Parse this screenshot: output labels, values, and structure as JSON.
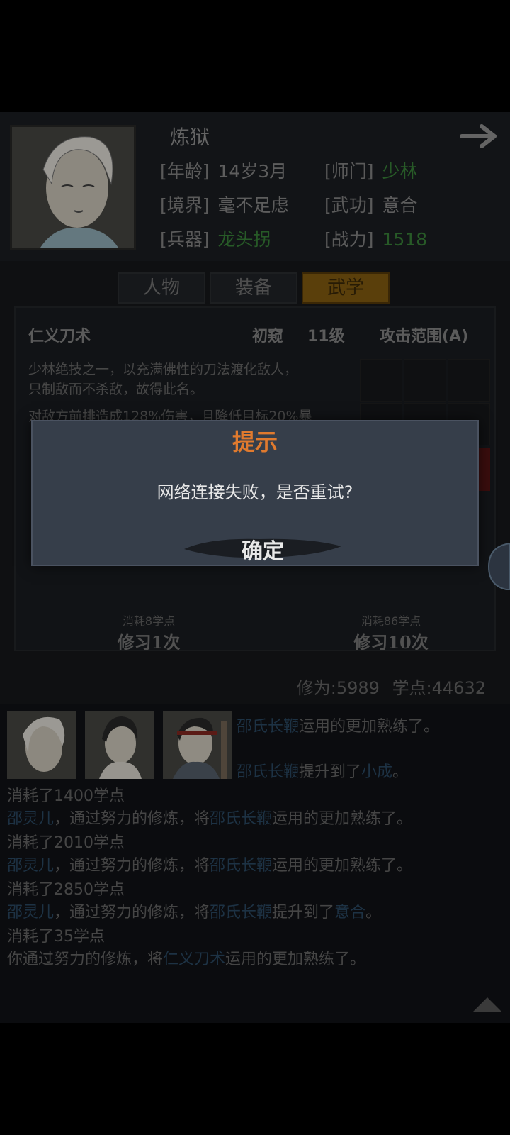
{
  "profile": {
    "name": "炼狱",
    "age_label": "[年龄]",
    "age": "14岁3月",
    "sect_label": "[师门]",
    "sect": "少林",
    "realm_label": "[境界]",
    "realm": "毫不足虑",
    "martial_label": "[武功]",
    "martial": "意合",
    "weapon_label": "[兵器]",
    "weapon": "龙头拐",
    "power_label": "[战力]",
    "power": "1518",
    "green_color": "#3d8a3d"
  },
  "tabs": [
    {
      "label": "人物",
      "active": false
    },
    {
      "label": "装备",
      "active": false
    },
    {
      "label": "武学",
      "active": true
    }
  ],
  "skill": {
    "name": "仁义刀术",
    "tier": "初窥",
    "level": "11级",
    "range": "攻击范围(A)",
    "desc1": "少林绝技之一，以充满佛性的刀法渡化敌人，",
    "desc2": "只制敌而不杀敌，故得此名。",
    "desc3": "对敌方前排造成128%伤害，且降低目标20%暴",
    "cost1": "消耗8学点",
    "learn1": "修习1次",
    "cost10": "消耗86学点",
    "learn10": "修习10次"
  },
  "stats": {
    "cultivation": "修为:5989",
    "points": "学点:44632"
  },
  "log": {
    "l1a": "邵氏长鞭",
    "l1b": "运用的更加熟练了。",
    "l2a": "邵氏长鞭",
    "l2b": "提升到了",
    "l2c": "小成",
    "l2d": "。",
    "l3": "消耗了1400学点",
    "l4a": "邵灵儿",
    "l4b": "，通过努力的修炼，将",
    "l4c": "邵氏长鞭",
    "l4d": "运用的更加熟练了。",
    "l5": "消耗了2010学点",
    "l6a": "邵灵儿",
    "l6b": "，通过努力的修炼，将",
    "l6c": "邵氏长鞭",
    "l6d": "运用的更加熟练了。",
    "l7": "消耗了2850学点",
    "l8a": "邵灵儿",
    "l8b": "，通过努力的修炼，将",
    "l8c": "邵氏长鞭",
    "l8d": "提升到了",
    "l8e": "意合",
    "l8f": "。",
    "l9": "消耗了35学点",
    "l10a": "你通过努力的修炼，将",
    "l10b": "仁义刀术",
    "l10c": "运用的更加熟练了。"
  },
  "dialog": {
    "title": "提示",
    "message": "网络连接失败，是否重试?",
    "confirm": "确定"
  },
  "icons": [
    "portrait-icon",
    "forward-arrow-icon",
    "scroll-up-icon"
  ]
}
